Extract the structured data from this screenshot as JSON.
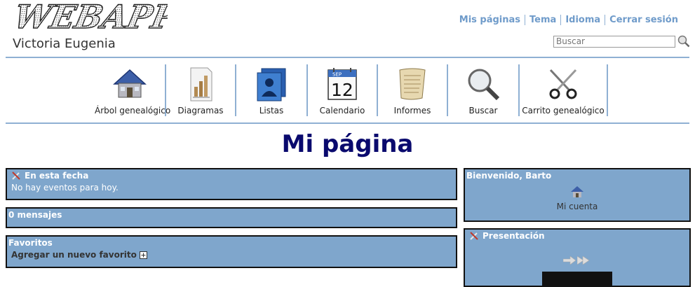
{
  "header": {
    "logo_text": "WEBAPPS",
    "site_title": "Victoria Eugenia",
    "links": [
      "Mis páginas",
      "Tema",
      "Idioma",
      "Cerrar sesión"
    ],
    "search_placeholder": "Buscar",
    "search_icon": "magnifier-icon"
  },
  "menu": [
    {
      "label": "Árbol genealógico",
      "icon": "house-icon"
    },
    {
      "label": "Diagramas",
      "icon": "chart-document-icon"
    },
    {
      "label": "Listas",
      "icon": "people-list-icon"
    },
    {
      "label": "Calendario",
      "icon": "calendar-icon",
      "month": "SEP",
      "day": "12"
    },
    {
      "label": "Informes",
      "icon": "scroll-icon"
    },
    {
      "label": "Buscar",
      "icon": "magnifier-icon"
    },
    {
      "label": "Carrito genealógico",
      "icon": "scissors-icon"
    }
  ],
  "page_title": "Mi página",
  "left_blocks": {
    "today": {
      "title": "En esta fecha",
      "body": "No hay eventos para hoy."
    },
    "messages": {
      "title": "0 mensajes"
    },
    "favorites": {
      "title": "Favoritos",
      "add_label": "Agregar un nuevo favorito"
    }
  },
  "right_blocks": {
    "welcome": {
      "title": "Bienvenido, Barto",
      "account_label": "Mi cuenta"
    },
    "presentation": {
      "title": "Presentación"
    }
  },
  "colors": {
    "accent": "#7fa6cc",
    "link": "#6f9bca",
    "title": "#0a0a6e",
    "rule": "#8fb0d3"
  }
}
